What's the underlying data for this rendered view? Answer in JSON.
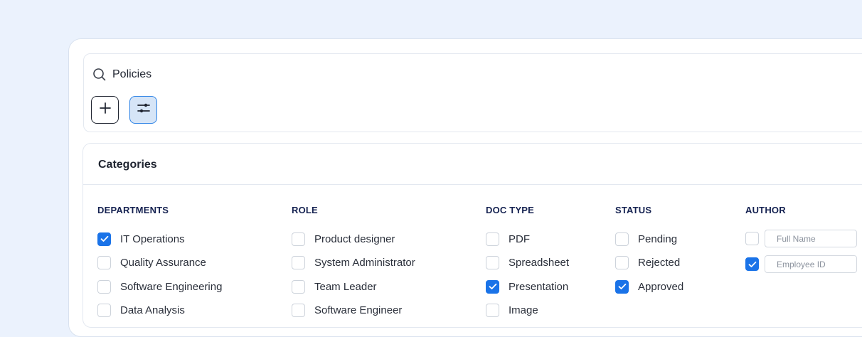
{
  "search": {
    "value": "Policies",
    "icon": "search-icon"
  },
  "toolbar": {
    "add_icon": "plus-icon",
    "filter_icon": "sliders-icon"
  },
  "colors": {
    "background": "#EBF2FD",
    "accent": "#1A73E8",
    "filter_button_bg": "#D6E5F7",
    "heading_text": "#152251"
  },
  "categories": {
    "title": "Categories",
    "departments": {
      "heading": "DEPARTMENTS",
      "options": [
        {
          "label": "IT Operations",
          "checked": true
        },
        {
          "label": "Quality Assurance",
          "checked": false
        },
        {
          "label": "Software Engineering",
          "checked": false
        },
        {
          "label": "Data Analysis",
          "checked": false
        }
      ]
    },
    "role": {
      "heading": "ROLE",
      "options": [
        {
          "label": "Product designer",
          "checked": false
        },
        {
          "label": "System Administrator",
          "checked": false
        },
        {
          "label": "Team Leader",
          "checked": false
        },
        {
          "label": "Software Engineer",
          "checked": false
        }
      ]
    },
    "doc_type": {
      "heading": "DOC TYPE",
      "options": [
        {
          "label": "PDF",
          "checked": false
        },
        {
          "label": "Spreadsheet",
          "checked": false
        },
        {
          "label": "Presentation",
          "checked": true
        },
        {
          "label": "Image",
          "checked": false
        }
      ]
    },
    "status": {
      "heading": "STATUS",
      "options": [
        {
          "label": "Pending",
          "checked": false
        },
        {
          "label": "Rejected",
          "checked": false
        },
        {
          "label": "Approved",
          "checked": true
        }
      ]
    },
    "author": {
      "heading": "AUTHOR",
      "fields": [
        {
          "placeholder": "Full Name",
          "value": "",
          "checked": false
        },
        {
          "placeholder": "Employee ID",
          "value": "",
          "checked": true
        }
      ]
    }
  }
}
